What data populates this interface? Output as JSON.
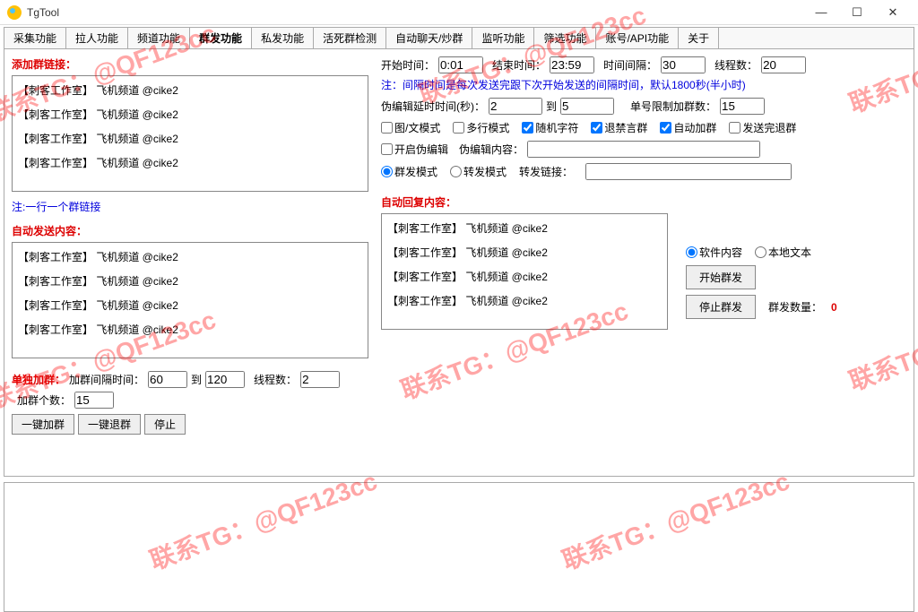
{
  "window": {
    "title": "TgTool"
  },
  "tabs": [
    "采集功能",
    "拉人功能",
    "频道功能",
    "群发功能",
    "私发功能",
    "活死群检测",
    "自动聊天/炒群",
    "监听功能",
    "筛选功能",
    "账号/API功能",
    "关于"
  ],
  "activeTab": 3,
  "linksLabel": "添加群链接：",
  "linkItems": [
    "【刺客工作室】 飞机频道 @cike2",
    "【刺客工作室】 飞机频道 @cike2",
    "【刺客工作室】 飞机频道 @cike2",
    "【刺客工作室】 飞机频道 @cike2"
  ],
  "noteLine": "注:一行一个群链接",
  "autoSendLabel": "自动发送内容：",
  "autoSendItems": [
    "【刺客工作室】 飞机频道 @cike2",
    "【刺客工作室】 飞机频道 @cike2",
    "【刺客工作室】 飞机频道 @cike2",
    "【刺客工作室】 飞机频道 @cike2"
  ],
  "autoReplyLabel": "自动回复内容：",
  "autoReplyItems": [
    "【刺客工作室】 飞机频道 @cike2",
    "【刺客工作室】 飞机频道 @cike2",
    "【刺客工作室】 飞机频道 @cike2",
    "【刺客工作室】 飞机频道 @cike2"
  ],
  "timing": {
    "startLabel": "开始时间：",
    "startVal": "0:01",
    "endLabel": "结束时间：",
    "endVal": "23:59",
    "intervalLabel": "时间间隔：",
    "intervalVal": "30",
    "threadsLabel": "线程数：",
    "threadsVal": "20"
  },
  "noteText": "注：间隔时间是每次发送完跟下次开始发送的间隔时间，默认1800秒(半小时)",
  "fakeEdit": {
    "delayLabel": "伪编辑延时时间(秒)：",
    "minVal": "2",
    "toLabel": "到",
    "maxVal": "5",
    "limitLabel": "单号限制加群数：",
    "limitVal": "15"
  },
  "checks": {
    "imgText": "图/文模式",
    "multiLine": "多行模式",
    "randChars": "随机字符",
    "banExit": "退禁言群",
    "autoJoin": "自动加群",
    "sendExit": "发送完退群",
    "enableFake": "开启伪编辑",
    "fakeContentLabel": "伪编辑内容："
  },
  "modes": {
    "groupSend": "群发模式",
    "forward": "转发模式",
    "forwardLinkLabel": "转发链接："
  },
  "singleJoin": {
    "label": "单独加群：",
    "intervalLabel": "加群间隔时间：",
    "minVal": "60",
    "toLabel": "到",
    "maxVal": "120",
    "threadsLabel": "线程数：",
    "threadsVal": "2",
    "countLabel": "加群个数：",
    "countVal": "15"
  },
  "buttons": {
    "joinAll": "一键加群",
    "exitAll": "一键退群",
    "stop": "停止",
    "startSend": "开始群发",
    "stopSend": "停止群发"
  },
  "source": {
    "soft": "软件内容",
    "local": "本地文本"
  },
  "stats": {
    "countLabel": "群发数量：",
    "countVal": "0"
  },
  "watermark": "联系TG：@QF123cc"
}
